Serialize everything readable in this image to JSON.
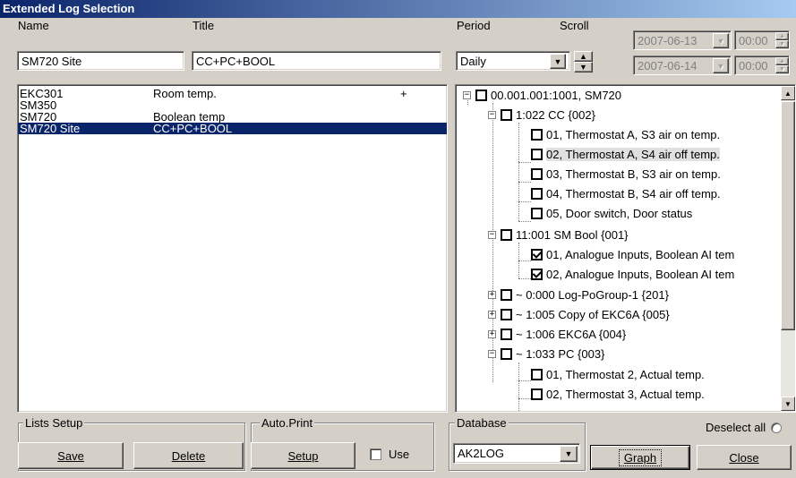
{
  "window": {
    "title": "Extended Log Selection"
  },
  "header": {
    "name_label": "Name",
    "title_label": "Title",
    "name_value": "SM720 Site",
    "title_value": "CC+PC+BOOL",
    "period_label": "Period",
    "scroll_label": "Scroll",
    "period_value": "Daily",
    "date_from": "2007-06-13",
    "time_from": "00:00",
    "date_to": "2007-06-14",
    "time_to": "00:00"
  },
  "log_list": [
    {
      "name": "EKC301",
      "title": "Room temp.",
      "flag": "+"
    },
    {
      "name": "SM350",
      "title": "",
      "flag": ""
    },
    {
      "name": "SM720",
      "title": "Boolean temp",
      "flag": ""
    },
    {
      "name": "SM720 Site",
      "title": "CC+PC+BOOL",
      "flag": ""
    }
  ],
  "tree": [
    {
      "text": "00.001.001:1001, SM720"
    },
    {
      "text": "1:022 CC  {002}"
    },
    {
      "text": "01, Thermostat A, S3 air on temp."
    },
    {
      "text": "02, Thermostat A, S4 air off temp."
    },
    {
      "text": "03, Thermostat B, S3 air on temp."
    },
    {
      "text": "04, Thermostat B, S4 air off temp."
    },
    {
      "text": "05, Door switch, Door status"
    },
    {
      "text": "11:001 SM Bool  {001}"
    },
    {
      "text": "01, Analogue Inputs, Boolean AI tem"
    },
    {
      "text": "02, Analogue Inputs, Boolean AI tem"
    },
    {
      "text": "~ 0:000 Log-PoGroup-1  {201}"
    },
    {
      "text": "~ 1:005 Copy of EKC6A  {005}"
    },
    {
      "text": "~ 1:006 EKC6A  {004}"
    },
    {
      "text": "~ 1:033 PC  {003}"
    },
    {
      "text": "01, Thermostat 2, Actual temp."
    },
    {
      "text": "02, Thermostat 3, Actual temp."
    }
  ],
  "bottom": {
    "lists_setup_label": "Lists Setup",
    "save_label": "Save",
    "delete_label": "Delete",
    "auto_print_label": "Auto.Print",
    "setup_label": "Setup",
    "use_label": "Use",
    "database_label": "Database",
    "database_value": "AK2LOG",
    "graph_label": "Graph",
    "close_label": "Close",
    "deselect_all_label": "Deselect all"
  }
}
